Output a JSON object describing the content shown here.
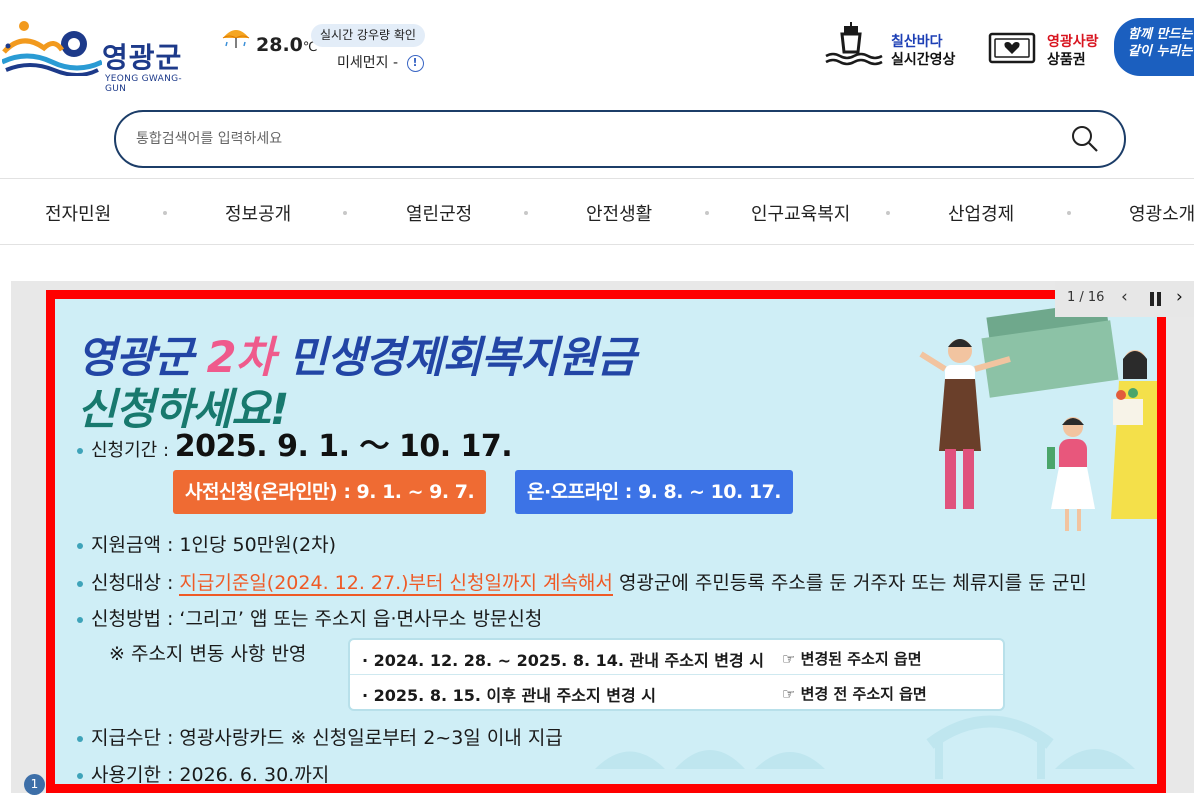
{
  "header": {
    "logo_name": "영광군",
    "logo_sub": "YEONG GWANG-GUN",
    "weather": {
      "icon": "umbrella-rain-icon",
      "temperature": "28.0",
      "unit": "℃"
    },
    "rain_button": "실시간 강우량 확인",
    "dust": {
      "label": "미세먼지",
      "value": "-",
      "info": "!"
    },
    "quick_links": [
      {
        "line1": "칠산바다",
        "line2": "실시간영상",
        "icon": "lighthouse-icon",
        "line1_color": "#1d3fb5"
      },
      {
        "line1": "영광사랑",
        "line2": "상품권",
        "icon": "gift-card-icon",
        "line1_color": "#d8141f"
      }
    ],
    "slogan": {
      "line1": "함께 만드는",
      "line2": "같이 누리는"
    }
  },
  "search": {
    "placeholder": "통합검색어를 입력하세요",
    "value": "",
    "button_icon": "search-icon"
  },
  "gnb": [
    "전자민원",
    "정보공개",
    "열린군정",
    "안전생활",
    "인구교육복지",
    "산업경제",
    "영광소개"
  ],
  "banner": {
    "title_part1": "영광군 ",
    "title_highlight": "2차",
    "title_part2": " 민생경제회복지원금",
    "title_line2": "신청하세요!",
    "period_label": "신청기간 : ",
    "period_value": "2025. 9. 1. ～ 10. 17.",
    "tag_pre": "사전신청(온라인만) : 9. 1. ~ 9. 7.",
    "tag_main": "온·오프라인 : 9. 8. ~ 10. 17.",
    "amount": "지원금액 : 1인당 50만원(2차)",
    "target_label": "신청대상 : ",
    "target_highlight": "지급기준일(2024. 12. 27.)부터 신청일까지 계속해서",
    "target_rest": " 영광군에 주민등록 주소를 둔 거주자 또는 체류지를 둔 군민",
    "method": "신청방법 : ‘그리고’ 앱 또는 주소지 읍·면사무소 방문신청",
    "note_label": "※ 주소지 변동 사항 반영",
    "note_rows": [
      {
        "text": "· 2024. 12. 28. ~ 2025. 8. 14. 관내 주소지 변경 시",
        "result": "☞ 변경된 주소지 읍면"
      },
      {
        "text": "· 2025. 8. 15. 이후 관내 주소지 변경 시",
        "result": "☞ 변경 전 주소지 읍면"
      }
    ],
    "payment": "지급수단 : 영광사랑카드    ※ 신청일로부터 2~3일 이내 지급",
    "deadline": "사용기한 : 2026. 6. 30.까지"
  },
  "slider": {
    "count": "1 / 16",
    "prev": "‹",
    "next": "›",
    "page_bullet": "1"
  }
}
